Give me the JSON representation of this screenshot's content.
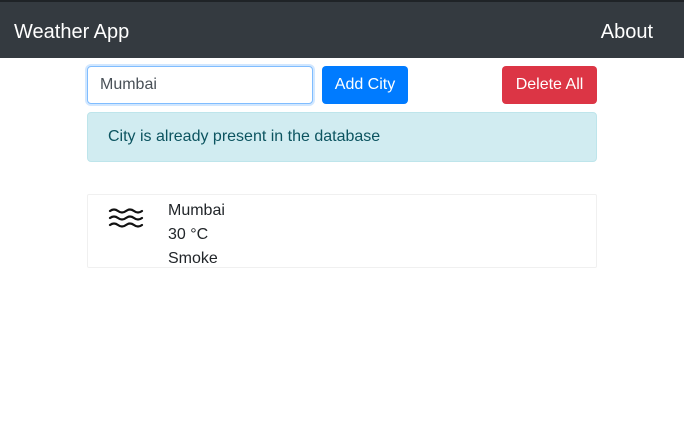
{
  "navbar": {
    "brand": "Weather App",
    "about": "About",
    "background": "#343a40"
  },
  "form": {
    "city_value": "Mumbai",
    "add_label": "Add City",
    "delete_label": "Delete All",
    "add_color": "#007bff",
    "delete_color": "#dc3545"
  },
  "alert": {
    "message": "City is already present in the database",
    "background": "#d1ecf1"
  },
  "cities": [
    {
      "name": "Mumbai",
      "temperature": "30 °C",
      "condition": "Smoke",
      "icon": "smoke-haze-icon"
    }
  ]
}
